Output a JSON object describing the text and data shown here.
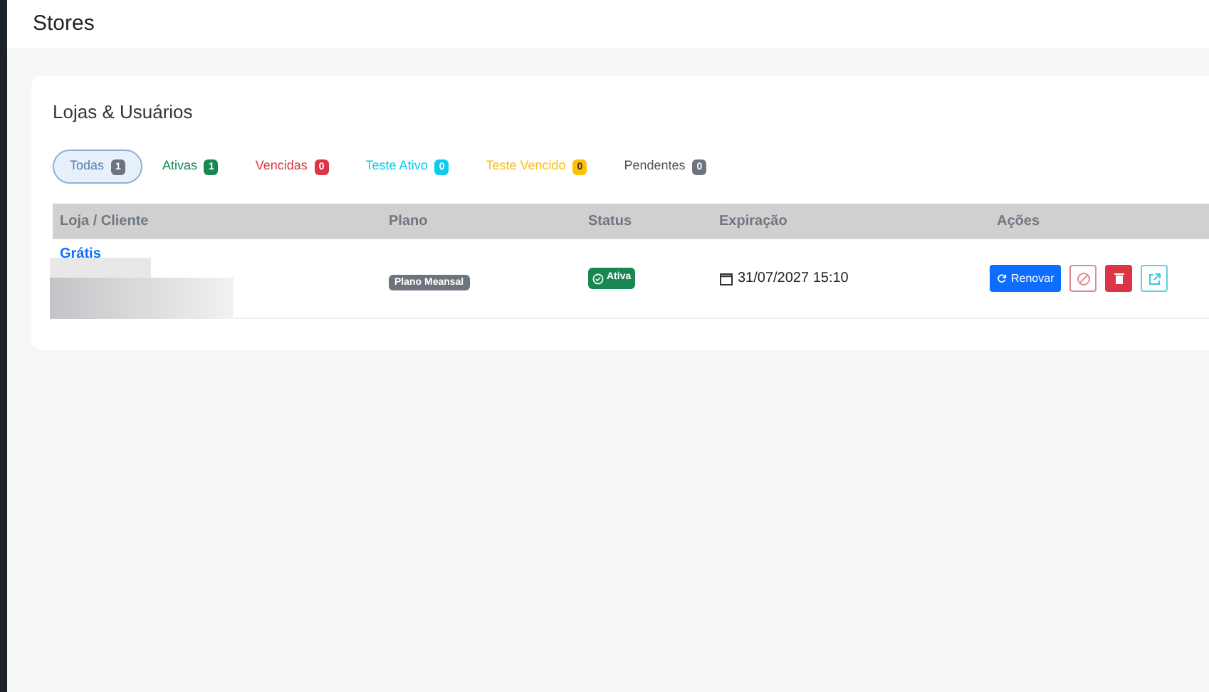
{
  "page_title": "Stores",
  "card": {
    "title": "Lojas & Usuários",
    "filters": [
      {
        "label": "Todas",
        "count": "1",
        "kind": "all",
        "selected": true
      },
      {
        "label": "Ativas",
        "count": "1",
        "kind": "green",
        "selected": false
      },
      {
        "label": "Vencidas",
        "count": "0",
        "kind": "red",
        "selected": false
      },
      {
        "label": "Teste Ativo",
        "count": "0",
        "kind": "cyan",
        "selected": false
      },
      {
        "label": "Teste Vencido",
        "count": "0",
        "kind": "yellow",
        "selected": false
      },
      {
        "label": "Pendentes",
        "count": "0",
        "kind": "gray",
        "selected": false
      }
    ],
    "table": {
      "columns": [
        "Loja / Cliente",
        "Plano",
        "Status",
        "Expiração",
        "Ações"
      ],
      "rows": [
        {
          "store": "Grátis",
          "plan": "Plano Meansal",
          "status": "Ativa",
          "expiration": "31/07/2027 15:10",
          "renew_label": "Renovar"
        }
      ]
    }
  }
}
